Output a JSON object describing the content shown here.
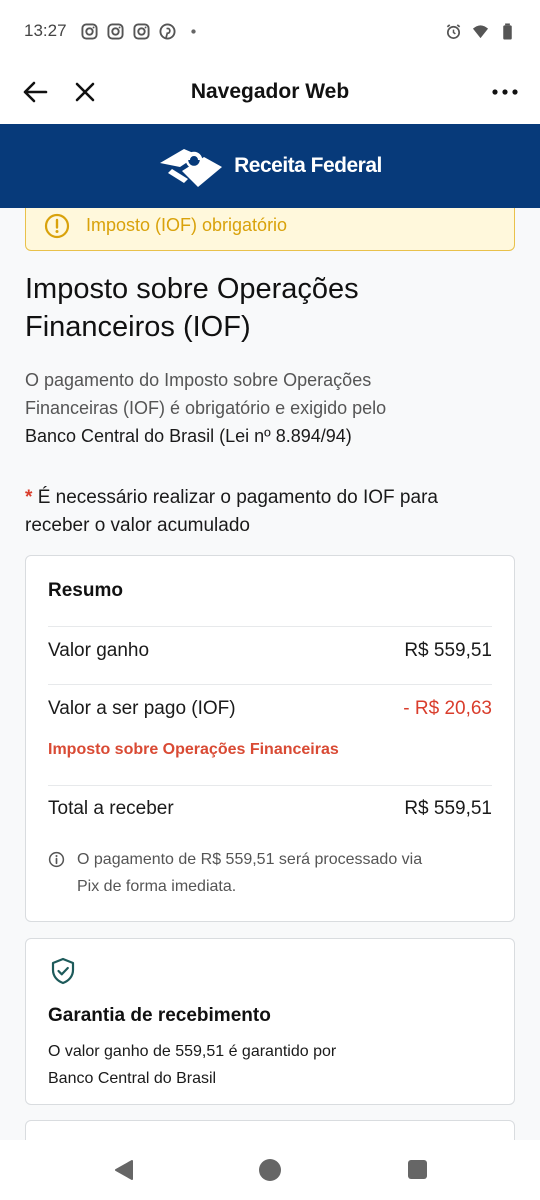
{
  "status_bar": {
    "time": "13:27",
    "left_icons": [
      "instagram-icon",
      "instagram-icon",
      "instagram-icon",
      "pinterest-icon",
      "dot-icon"
    ],
    "right_icons": [
      "alarm-icon",
      "wifi-icon",
      "battery-icon"
    ]
  },
  "app_bar": {
    "title": "Navegador Web",
    "back_icon": "arrow-left-icon",
    "close_icon": "close-icon",
    "menu_icon": "more-horizontal-icon"
  },
  "site_header": {
    "logo_text": "Receita Federal",
    "background": "#073a7a"
  },
  "alert": {
    "text": "Imposto (IOF) obrigatório",
    "icon": "warning-circle-icon",
    "color": "#d9a20b"
  },
  "page": {
    "title_line1": "Imposto sobre Operações",
    "title_line2": "Financeiros (IOF)",
    "intro_line1": "O pagamento do Imposto sobre Operações",
    "intro_line2": "Financeiras (IOF) é obrigatório e exigido pelo",
    "intro_line3": "Banco Central do Brasil (Lei nº 8.894/94)",
    "required_star": "*",
    "required_line1": "É necessário realizar o pagamento do IOF para",
    "required_line2": "receber o valor acumulado"
  },
  "summary": {
    "title": "Resumo",
    "rows": [
      {
        "label": "Valor ganho",
        "value": "R$ 559,51"
      },
      {
        "label": "Valor a ser pago (IOF)",
        "value": "- R$ 20,63"
      },
      {
        "label": "Total a receber",
        "value": "R$ 559,51"
      }
    ],
    "tax_description": "Imposto sobre Operações Financeiras",
    "info_line1": "O pagamento de R$ 559,51 será processado via",
    "info_line2": "Pix de forma imediata.",
    "accent_red": "#d93d2c"
  },
  "guarantee": {
    "title": "Garantia de recebimento",
    "text_line1": "O valor ganho de 559,51 é garantido por",
    "text_line2": "Banco Central do Brasil",
    "icon": "shield-check-icon",
    "icon_color": "#1d5a5a"
  },
  "system_nav": {
    "back": "nav-back-icon",
    "home": "nav-home-icon",
    "recent": "nav-recent-icon"
  }
}
